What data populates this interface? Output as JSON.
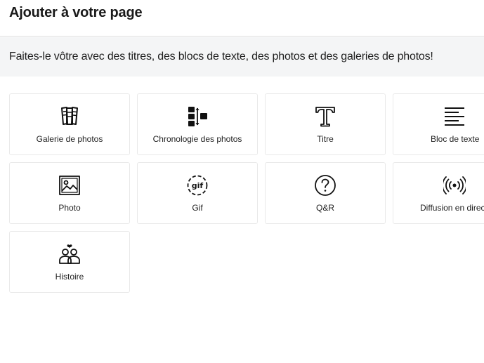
{
  "header": {
    "title": "Ajouter à votre page"
  },
  "banner": {
    "text": "Faites-le vôtre avec des titres, des blocs de texte, des photos et des galeries de photos!"
  },
  "cards": [
    {
      "label": "Galerie de photos",
      "icon": "photo-gallery-icon"
    },
    {
      "label": "Chronologie des photos",
      "icon": "timeline-icon"
    },
    {
      "label": "Titre",
      "icon": "title-icon"
    },
    {
      "label": "Bloc de texte",
      "icon": "text-block-icon"
    },
    {
      "label": "Photo",
      "icon": "photo-icon"
    },
    {
      "label": "Gif",
      "icon": "gif-icon"
    },
    {
      "label": "Q&R",
      "icon": "question-icon"
    },
    {
      "label": "Diffusion en direct",
      "icon": "broadcast-icon"
    },
    {
      "label": "Histoire",
      "icon": "story-icon"
    }
  ],
  "gif_icon_text": "gif"
}
